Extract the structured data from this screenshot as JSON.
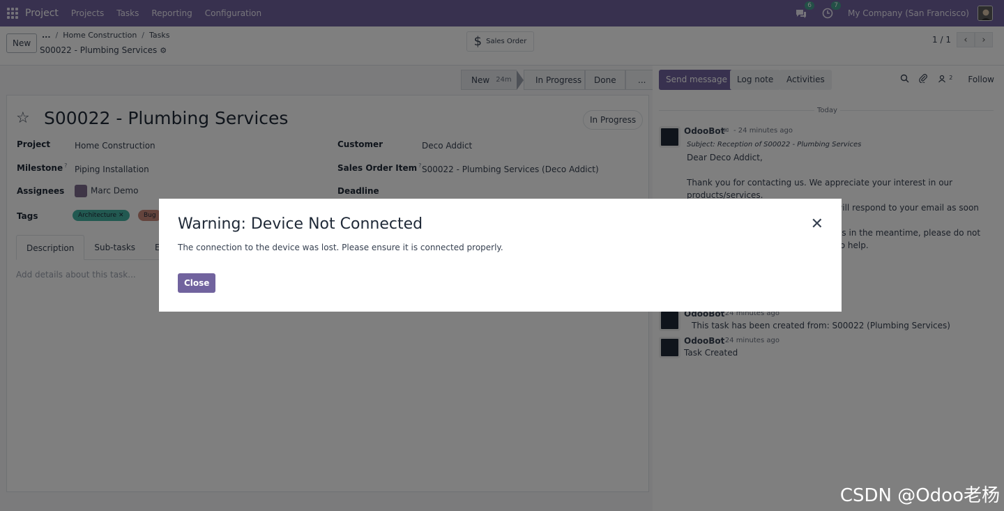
{
  "navbar": {
    "app_name": "Project",
    "menu": [
      "Projects",
      "Tasks",
      "Reporting",
      "Configuration"
    ],
    "messages_count": "6",
    "activities_count": "7",
    "company": "My Company (San Francisco)"
  },
  "control": {
    "new_label": "New",
    "breadcrumb_more": "...",
    "breadcrumb": [
      "Home Construction",
      "Tasks"
    ],
    "record_name": "S00022 - Plumbing Services",
    "smart_button": "Sales Order",
    "pager": "1 / 1"
  },
  "statusbar": {
    "stages": [
      "New",
      "In Progress",
      "Done",
      "..."
    ],
    "new_duration": "24m"
  },
  "form": {
    "title": "S00022 - Plumbing Services",
    "state": "In Progress",
    "project_label": "Project",
    "project_value": "Home Construction",
    "milestone_label": "Milestone",
    "milestone_value": "Piping Installation",
    "assignees_label": "Assignees",
    "assignees_value": "Marc Demo",
    "tags_label": "Tags",
    "tags": [
      "Architecture",
      "Bug"
    ],
    "customer_label": "Customer",
    "customer_value": "Deco Addict",
    "so_item_label": "Sales Order Item",
    "so_item_value": "S00022 - Plumbing Services (Deco Addict)",
    "deadline_label": "Deadline",
    "help_mark": "?",
    "tabs": [
      "Description",
      "Sub-tasks",
      "Extra Info"
    ],
    "description_placeholder": "Add details about this task..."
  },
  "chatter": {
    "send_message": "Send message",
    "log_note": "Log note",
    "activities": "Activities",
    "followers_count": "2",
    "follow": "Follow",
    "day": "Today",
    "messages": [
      {
        "author": "OdooBot",
        "time": "- 24 minutes ago",
        "subject": "Subject: Reception of S00022 - Plumbing Services",
        "lines": [
          "Dear Deco Addict,",
          "Thank you for contacting us. We appreciate your interest in our products/services.",
          "We have received your inquiry and will respond to your email as soon as possible.",
          "If you have any questions or concerns in the meantime, please do not hesitate to contact us. We are here to help."
        ]
      },
      {
        "author": "OdooBot",
        "time": "- 24 minutes ago",
        "body": "This task has been created from: S00022 (Plumbing Services)"
      },
      {
        "author": "OdooBot",
        "time": "- 24 minutes ago",
        "body": "Task Created"
      }
    ]
  },
  "modal": {
    "title": "Warning: Device Not Connected",
    "body": "The connection to the device was lost. Please ensure it is connected properly.",
    "close_label": "Close"
  },
  "watermark": "CSDN @Odoo老杨",
  "colors": {
    "brand": "#71639e",
    "tag_architecture": "#45b3a3",
    "tag_bug": "#c9897b"
  }
}
